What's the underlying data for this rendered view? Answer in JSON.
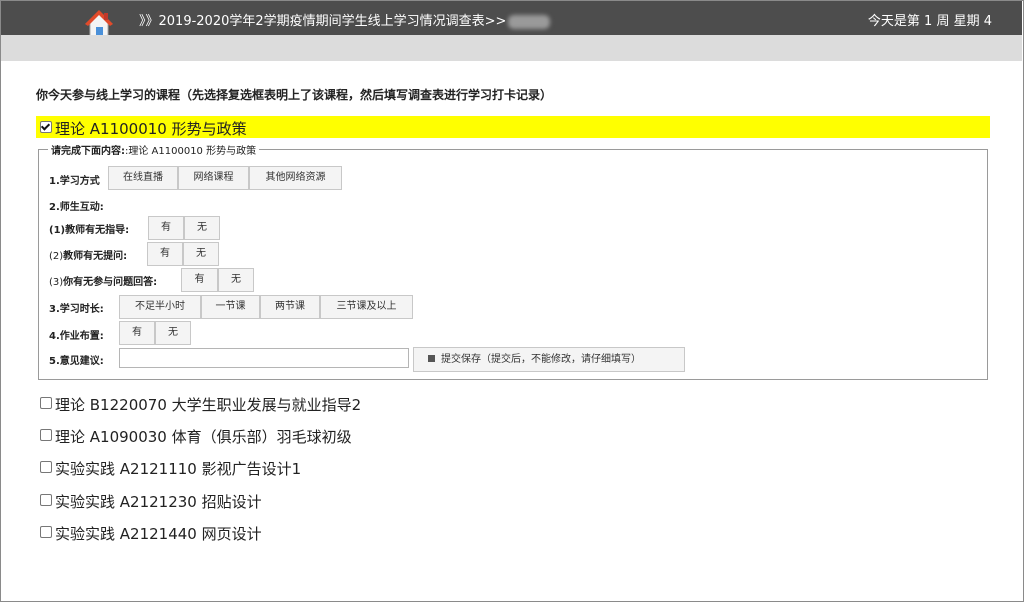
{
  "header": {
    "title": "》》2019-2020学年2学期疫情期间学生线上学习情况调查表>>",
    "week": "今天是第 1 周 星期 4"
  },
  "question": "你今天参与线上学习的课程（先选择复选框表明上了该课程，然后填写调查表进行学习打卡记录）",
  "active_course": {
    "label": "理论 A1100010 形势与政策",
    "checked": true
  },
  "form": {
    "legend_bold": "请完成下面内容:",
    "legend_course": ":理论 A1100010 形势与政策",
    "study_method": {
      "label": "1.学习方式",
      "options": [
        "在线直播",
        "网络课程",
        "其他网络资源"
      ]
    },
    "interaction": {
      "label": "2.师生互动:"
    },
    "guidance": {
      "label": "(1)教师有无指导:",
      "options": [
        "有",
        "无"
      ]
    },
    "questioning": {
      "label_num": "(2)",
      "label_text": "教师有无提问:",
      "options": [
        "有",
        "无"
      ]
    },
    "answering": {
      "label_num": "(3)",
      "label_text": "你有无参与问题回答:",
      "options": [
        "有",
        "无"
      ]
    },
    "duration": {
      "label": "3.学习时长:",
      "options": [
        "不足半小时",
        "一节课",
        "两节课",
        "三节课及以上"
      ]
    },
    "homework": {
      "label": "4.作业布置:",
      "options": [
        "有",
        "无"
      ]
    },
    "suggestion": {
      "label": "5.意见建议:",
      "value": ""
    },
    "submit_label": "提交保存（提交后，不能修改，请仔细填写）"
  },
  "courses": [
    {
      "label": "理论 B1220070 大学生职业发展与就业指导2",
      "checked": false
    },
    {
      "label": "理论 A1090030 体育（俱乐部）羽毛球初级",
      "checked": false
    },
    {
      "label": "实验实践 A2121110 影视广告设计1",
      "checked": false
    },
    {
      "label": "实验实践 A2121230 招贴设计",
      "checked": false
    },
    {
      "label": "实验实践 A2121440 网页设计",
      "checked": false
    }
  ],
  "colors": {
    "topbar": "#4d4d4d",
    "subbar": "#dcdcdc",
    "highlight": "#ffff00"
  },
  "icons": {
    "home": "home-icon",
    "checkbox": "checkbox-icon",
    "save": "save-icon"
  }
}
